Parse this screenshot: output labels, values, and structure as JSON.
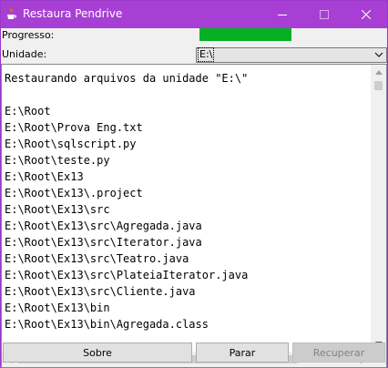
{
  "window": {
    "title": "Restaura Pendrive",
    "icons": {
      "app": "java-cup-icon",
      "minimize": "minimize-icon",
      "maximize": "maximize-icon",
      "close": "close-icon"
    }
  },
  "form": {
    "progress_label": "Progresso:",
    "progress_value": 0.49,
    "progress_color": "#06b025",
    "unit_label": "Unidade:",
    "unit_value": "E:\\"
  },
  "log": {
    "lines": [
      "Restaurando arquivos da unidade \"E:\\\"",
      "",
      "E:\\Root",
      "E:\\Root\\Prova Eng.txt",
      "E:\\Root\\sqlscript.py",
      "E:\\Root\\teste.py",
      "E:\\Root\\Ex13",
      "E:\\Root\\Ex13\\.project",
      "E:\\Root\\Ex13\\src",
      "E:\\Root\\Ex13\\src\\Agregada.java",
      "E:\\Root\\Ex13\\src\\Iterator.java",
      "E:\\Root\\Ex13\\src\\Teatro.java",
      "E:\\Root\\Ex13\\src\\PlateiaIterator.java",
      "E:\\Root\\Ex13\\src\\Cliente.java",
      "E:\\Root\\Ex13\\bin",
      "E:\\Root\\Ex13\\bin\\Agregada.class"
    ]
  },
  "buttons": {
    "sobre": "Sobre",
    "parar": "Parar",
    "recuperar": "Recuperar"
  },
  "colors": {
    "titlebar": "#a83fd4",
    "disabled_text": "#838383"
  }
}
